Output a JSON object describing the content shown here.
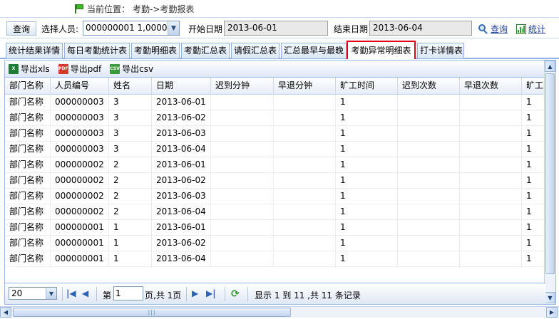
{
  "breadcrumb": {
    "prefix": "当前位置：",
    "path": "考勤->考勤报表"
  },
  "query": {
    "query_button": "查询",
    "person_label": "选择人员:",
    "person_value": "000000001 1,0000",
    "start_label": "开始日期",
    "start_value": "2013-06-01",
    "end_label": "结束日期",
    "end_value": "2013-06-04",
    "search_link": "查询",
    "stats_link": "统计"
  },
  "tabs": [
    {
      "label": "统计结果详情",
      "active": false
    },
    {
      "label": "每日考勤统计表",
      "active": false
    },
    {
      "label": "考勤明细表",
      "active": false
    },
    {
      "label": "考勤汇总表",
      "active": false
    },
    {
      "label": "请假汇总表",
      "active": false
    },
    {
      "label": "汇总最早与最晚",
      "active": false
    },
    {
      "label": "考勤异常明细表",
      "active": true
    },
    {
      "label": "打卡详情表",
      "active": false
    }
  ],
  "toolbar": {
    "export_xls": "导出xls",
    "export_pdf": "导出pdf",
    "export_csv": "导出csv"
  },
  "table": {
    "columns": [
      "部门名称",
      "人员编号",
      "姓名",
      "日期",
      "迟到分钟",
      "早退分钟",
      "旷工时间",
      "迟到次数",
      "早退次数",
      "旷工次"
    ],
    "rows": [
      [
        "部门名称",
        "000000003",
        "3",
        "2013-06-01",
        "",
        "",
        "1",
        "",
        "",
        "1"
      ],
      [
        "部门名称",
        "000000003",
        "3",
        "2013-06-02",
        "",
        "",
        "1",
        "",
        "",
        "1"
      ],
      [
        "部门名称",
        "000000003",
        "3",
        "2013-06-03",
        "",
        "",
        "1",
        "",
        "",
        "1"
      ],
      [
        "部门名称",
        "000000003",
        "3",
        "2013-06-04",
        "",
        "",
        "1",
        "",
        "",
        "1"
      ],
      [
        "部门名称",
        "000000002",
        "2",
        "2013-06-01",
        "",
        "",
        "1",
        "",
        "",
        "1"
      ],
      [
        "部门名称",
        "000000002",
        "2",
        "2013-06-02",
        "",
        "",
        "1",
        "",
        "",
        "1"
      ],
      [
        "部门名称",
        "000000002",
        "2",
        "2013-06-03",
        "",
        "",
        "1",
        "",
        "",
        "1"
      ],
      [
        "部门名称",
        "000000002",
        "2",
        "2013-06-04",
        "",
        "",
        "1",
        "",
        "",
        "1"
      ],
      [
        "部门名称",
        "000000001",
        "1",
        "2013-06-01",
        "",
        "",
        "1",
        "",
        "",
        "1"
      ],
      [
        "部门名称",
        "000000001",
        "1",
        "2013-06-02",
        "",
        "",
        "1",
        "",
        "",
        "1"
      ],
      [
        "部门名称",
        "000000001",
        "1",
        "2013-06-04",
        "",
        "",
        "1",
        "",
        "",
        "1"
      ]
    ]
  },
  "pager": {
    "page_size": "20",
    "page_label": "第",
    "page_value": "1",
    "page_total": "页,共 1页",
    "summary": "显示 1 到 11 ,共 11 条记录"
  },
  "colors": {
    "accent_border": "#99bbe8",
    "active_tab_border": "#e0001b",
    "link": "#1e3f99"
  },
  "icons": [
    "flag-icon",
    "magnifier-icon",
    "chart-icon",
    "excel-icon",
    "pdf-icon",
    "csv-icon",
    "first-page-icon",
    "prev-page-icon",
    "next-page-icon",
    "last-page-icon",
    "refresh-icon"
  ]
}
